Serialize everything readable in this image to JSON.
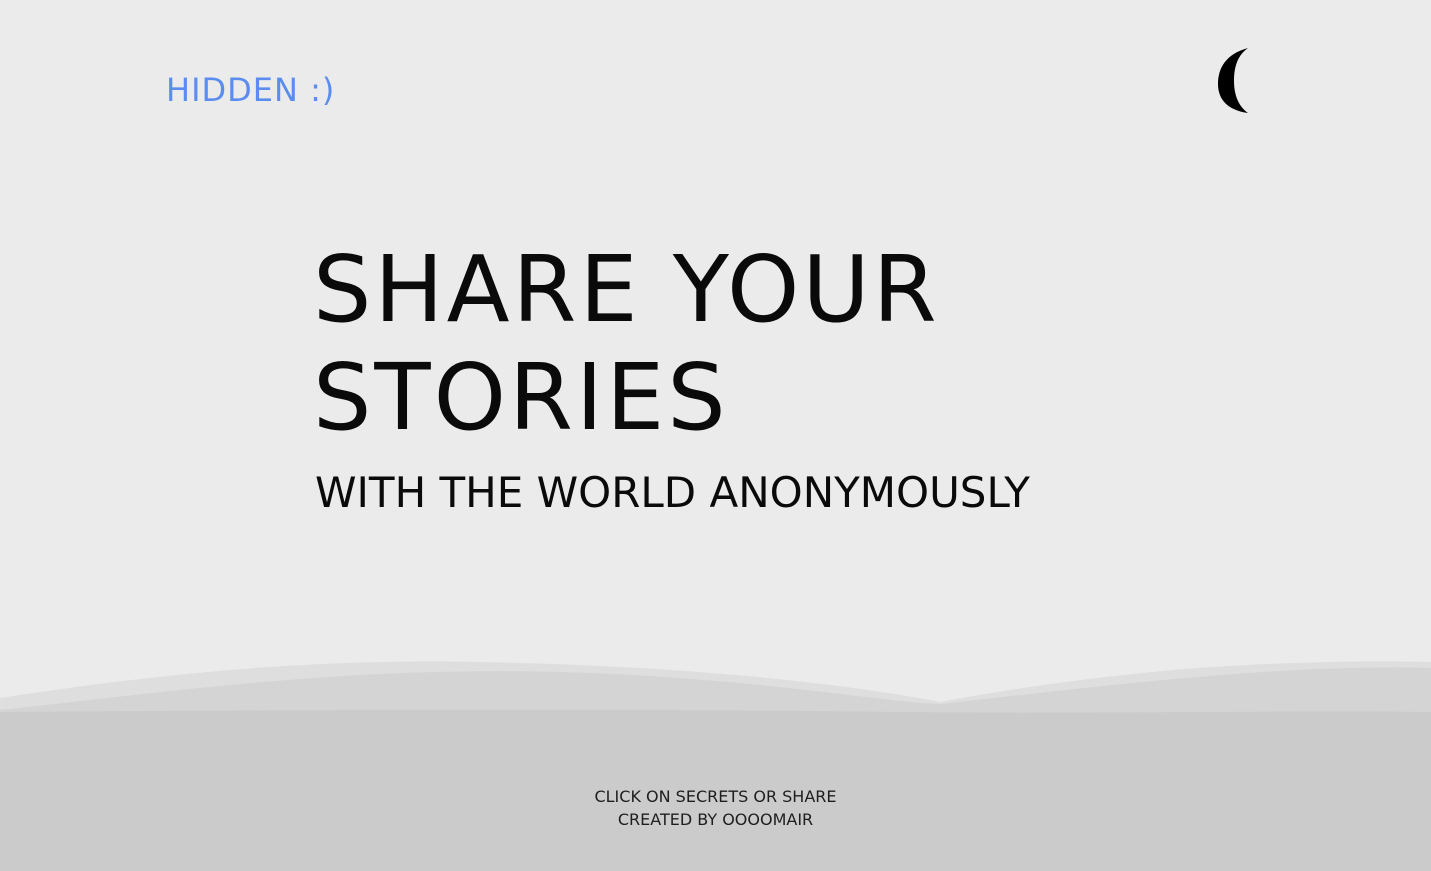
{
  "header": {
    "logo_text": "HIDDEN :)",
    "theme_toggle_icon": "moon-icon"
  },
  "hero": {
    "title_line1": "SHARE YOUR",
    "title_line2": "STORIES",
    "subtitle": "WITH THE WORLD ANONYMOUSLY"
  },
  "footer": {
    "line1": "CLICK ON SECRETS OR SHARE",
    "line2": "CREATED BY OOOOMAIR"
  },
  "colors": {
    "background": "#ebebeb",
    "logo": "#5b8def",
    "text": "#0a0a0a",
    "wave_light": "#dcdcdc",
    "wave_dark": "#cbcbcb"
  }
}
